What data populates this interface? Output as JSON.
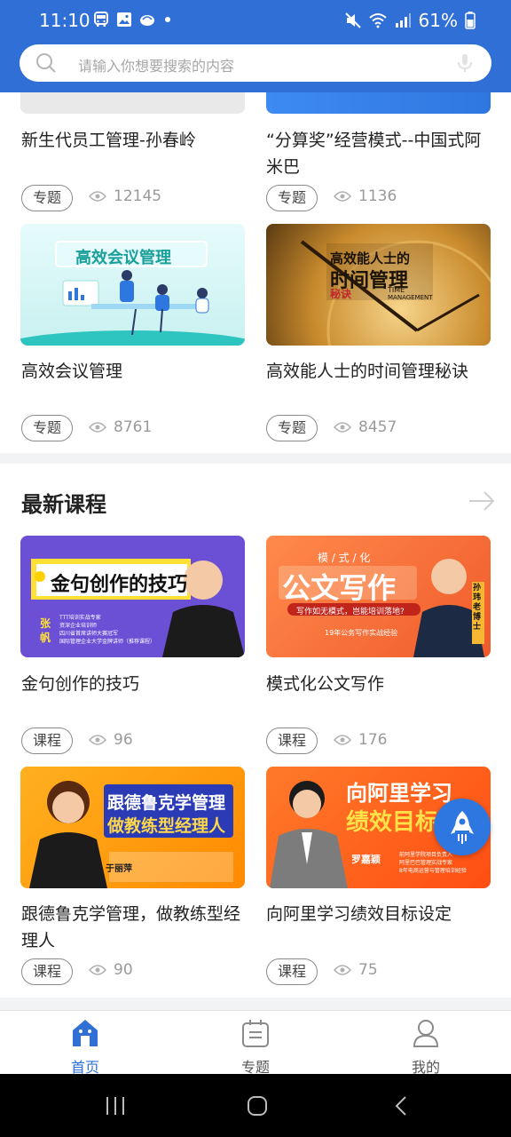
{
  "status_bar": {
    "time": "11:10",
    "battery": "61%"
  },
  "search": {
    "placeholder": "请输入你想要搜索的内容"
  },
  "top_cards": [
    {
      "title": "新生代员工管理-孙春岭",
      "tag": "专题",
      "views": "12145"
    },
    {
      "title": "“分算奖”经营模式--中国式阿米巴",
      "tag": "专题",
      "views": "1136"
    },
    {
      "title": "高效会议管理",
      "tag": "专题",
      "views": "8761",
      "thumb_text": "高效会议管理"
    },
    {
      "title": "高效能人士的时间管理秘诀",
      "tag": "专题",
      "views": "8457",
      "thumb_text_1": "高效能人士的",
      "thumb_text_2": "时间管理",
      "thumb_text_3": "秘诀",
      "thumb_text_4": "TIME",
      "thumb_text_5": "MANAGEMENT"
    }
  ],
  "latest": {
    "title": "最新课程",
    "courses": [
      {
        "title": "金句创作的技巧",
        "tag": "课程",
        "views": "96",
        "thumb_text": "金句创作的技巧",
        "thumb_name_1": "张",
        "thumb_name_2": "帆",
        "thumb_lines": [
          "TTT培训实战专家",
          "资深企业培训师",
          "四川省首席讲师大赛冠军",
          "国际管理企业大学金牌讲师（推荐课程）"
        ]
      },
      {
        "title": "模式化公文写作",
        "tag": "课程",
        "views": "176",
        "thumb_text_1": "模 / 式 / 化",
        "thumb_text_2": "公文写作",
        "thumb_text_3": "写作如无模式，岂能培训落地?",
        "thumb_text_4": "19年公务写作实战经验",
        "thumb_badge": "孙玮老博士"
      },
      {
        "title": "跟德鲁克学管理，做教练型经理人",
        "tag": "课程",
        "views": "90",
        "thumb_text_1": "跟德鲁克学管理",
        "thumb_text_2": "做教练型经理人",
        "thumb_name": "于丽萍"
      },
      {
        "title": "向阿里学习绩效目标设定",
        "tag": "课程",
        "views": "75",
        "thumb_text_1": "向阿里学习",
        "thumb_text_2": "绩效目标",
        "thumb_name": "罗嘉颖",
        "thumb_lines": [
          "前阿里学院项目负责人",
          "阿里巴巴管理实战专家",
          "8年电商运营与管理培训经验"
        ]
      }
    ]
  },
  "bottom_nav": [
    {
      "label": "首页",
      "icon": "home-icon",
      "active": true
    },
    {
      "label": "专题",
      "icon": "topic-icon",
      "active": false
    },
    {
      "label": "我的",
      "icon": "user-icon",
      "active": false
    }
  ],
  "colors": {
    "primary": "#2f6fd6",
    "tag_border": "#8a8a8a",
    "muted": "#9a9a9a"
  }
}
